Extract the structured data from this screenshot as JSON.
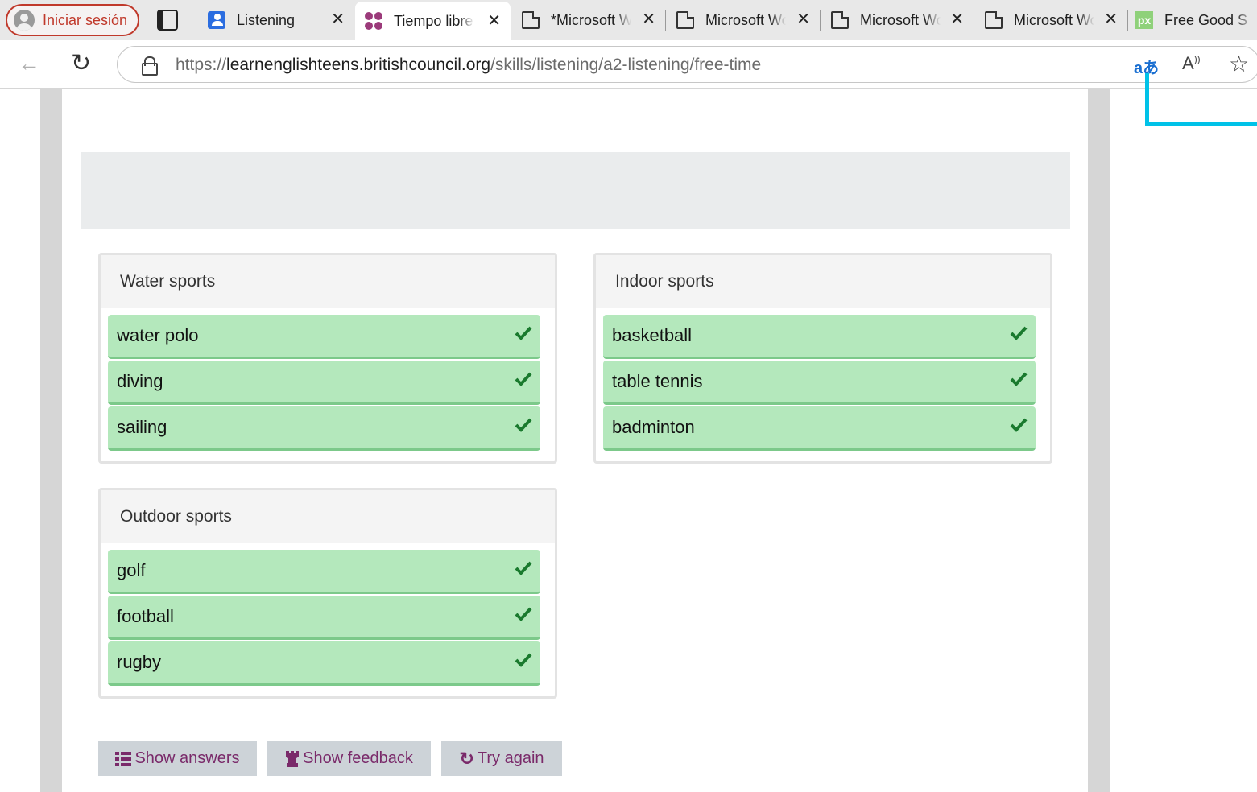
{
  "browser": {
    "profile_label": "Iniciar sesión",
    "tabs": [
      {
        "title": "Listening",
        "active": false
      },
      {
        "title": "Tiempo libre",
        "active": true
      },
      {
        "title": "*Microsoft Word",
        "active": false
      },
      {
        "title": "Microsoft Word",
        "active": false
      },
      {
        "title": "Microsoft Word",
        "active": false
      },
      {
        "title": "Microsoft Word",
        "active": false
      },
      {
        "title": "Free Good S",
        "active": false
      }
    ],
    "url_scheme": "https://",
    "url_host": "learnenglishteens.britishcouncil.org",
    "url_path": "/skills/listening/a2-listening/free-time",
    "favicon_px_label": "px"
  },
  "groups": [
    {
      "title": "Water sports",
      "items": [
        "water polo",
        "diving",
        "sailing"
      ]
    },
    {
      "title": "Indoor sports",
      "items": [
        "basketball",
        "table tennis",
        "badminton"
      ]
    },
    {
      "title": "Outdoor sports",
      "items": [
        "golf",
        "football",
        "rugby"
      ]
    }
  ],
  "buttons": {
    "show_answers": "Show answers",
    "show_feedback": "Show feedback",
    "try_again": "Try again"
  },
  "colors": {
    "correct_bg": "#b4e8bc",
    "check": "#1a7a2e",
    "button_text": "#7a2a6a",
    "profile_accent": "#c0392b"
  }
}
